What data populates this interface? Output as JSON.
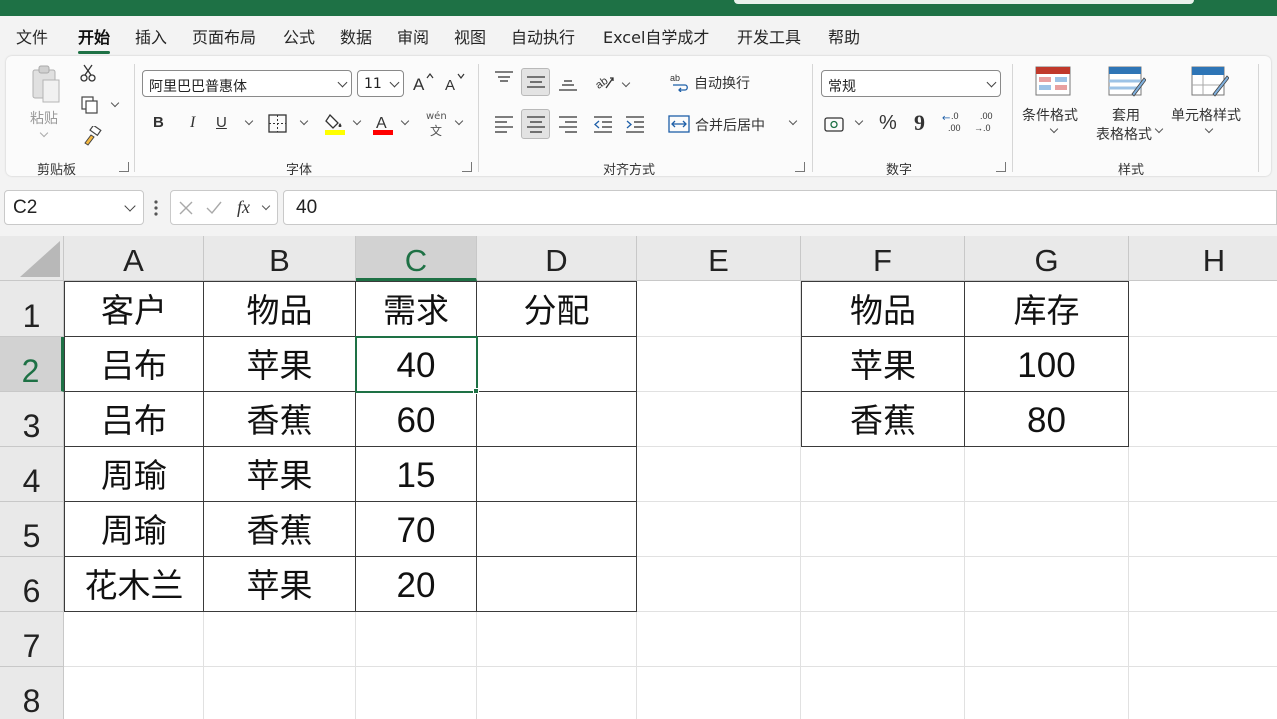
{
  "menu": {
    "tabs": [
      "文件",
      "开始",
      "插入",
      "页面布局",
      "公式",
      "数据",
      "审阅",
      "视图",
      "自动执行",
      "Excel自学成才",
      "开发工具",
      "帮助"
    ],
    "active_tab": "开始"
  },
  "ribbon": {
    "clipboard": {
      "paste_label": "粘贴",
      "group_label": "剪贴板"
    },
    "font": {
      "font_name": "阿里巴巴普惠体",
      "font_size": "11",
      "bold": "B",
      "italic": "I",
      "underline": "U",
      "phonetic": "wén",
      "group_label": "字体",
      "fill_color": "#ffff00",
      "font_color": "#ff0000"
    },
    "alignment": {
      "wrap_text": "自动换行",
      "merge_center": "合并后居中",
      "group_label": "对齐方式"
    },
    "number": {
      "format": "常规",
      "percent": "%",
      "comma": "9",
      "inc_decimal_top": ".0",
      "inc_decimal_bottom": ".00",
      "dec_decimal_top": ".00",
      "dec_decimal_bottom": "→.0",
      "group_label": "数字"
    },
    "styles": {
      "conditional": "条件格式",
      "table_line1": "套用",
      "table_line2": "表格格式",
      "cell_styles": "单元格样式",
      "group_label": "样式"
    }
  },
  "formula_bar": {
    "name_box": "C2",
    "fx": "fx",
    "value": "40"
  },
  "sheet": {
    "columns": [
      "A",
      "B",
      "C",
      "D",
      "E",
      "F",
      "G",
      "H"
    ],
    "rows": [
      "1",
      "2",
      "3",
      "4",
      "5",
      "6",
      "7",
      "8"
    ],
    "selected_column": "C",
    "selected_row": "2",
    "main_table": {
      "headers": [
        "客户",
        "物品",
        "需求",
        "分配"
      ],
      "rows": [
        [
          "吕布",
          "苹果",
          "40",
          ""
        ],
        [
          "吕布",
          "香蕉",
          "60",
          ""
        ],
        [
          "周瑜",
          "苹果",
          "15",
          ""
        ],
        [
          "周瑜",
          "香蕉",
          "70",
          ""
        ],
        [
          "花木兰",
          "苹果",
          "20",
          ""
        ]
      ]
    },
    "stock_table": {
      "headers": [
        "物品",
        "库存"
      ],
      "rows": [
        [
          "苹果",
          "100"
        ],
        [
          "香蕉",
          "80"
        ]
      ]
    },
    "accent_color": "#1e7145"
  }
}
